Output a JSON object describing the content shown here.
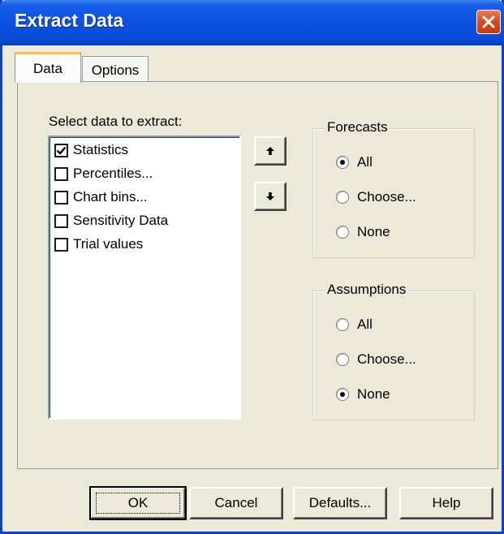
{
  "window": {
    "title": "Extract Data"
  },
  "tabs": [
    {
      "label": "Data",
      "active": true
    },
    {
      "label": "Options",
      "active": false
    }
  ],
  "select_data": {
    "heading": "Select data to extract:",
    "items": [
      {
        "label": "Statistics",
        "checked": true
      },
      {
        "label": "Percentiles...",
        "checked": false
      },
      {
        "label": "Chart bins...",
        "checked": false
      },
      {
        "label": "Sensitivity Data",
        "checked": false
      },
      {
        "label": "Trial values",
        "checked": false
      }
    ]
  },
  "move_buttons": {
    "up_icon": "arrow-up-icon",
    "down_icon": "arrow-down-icon"
  },
  "forecasts": {
    "title": "Forecasts",
    "options": [
      {
        "label": "All",
        "selected": true
      },
      {
        "label": "Choose...",
        "selected": false
      },
      {
        "label": "None",
        "selected": false
      }
    ]
  },
  "assumptions": {
    "title": "Assumptions",
    "options": [
      {
        "label": "All",
        "selected": false
      },
      {
        "label": "Choose...",
        "selected": false
      },
      {
        "label": "None",
        "selected": true
      }
    ]
  },
  "buttons": {
    "ok": "OK",
    "cancel": "Cancel",
    "defaults": "Defaults...",
    "help": "Help"
  },
  "colors": {
    "titlebar": "#0c52e3",
    "dialog_bg": "#ece9d8",
    "close": "#d74a22"
  }
}
